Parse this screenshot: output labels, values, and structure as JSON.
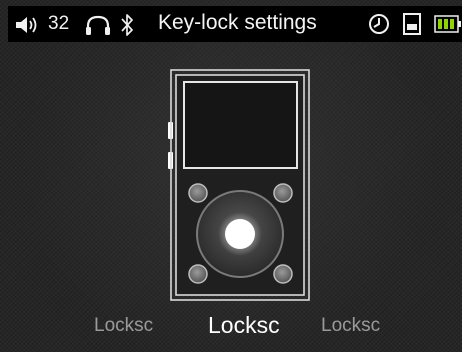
{
  "status_bar": {
    "volume_icon": "speaker-icon",
    "volume_level": "32",
    "headphone_icon": "headphone-icon",
    "bluetooth_icon": "bluetooth-icon",
    "title": "Key-lock settings",
    "clock_icon": "clock-icon",
    "sd_card_icon": "sd-card-icon",
    "battery_icon": "battery-icon",
    "battery_color": "#8fd400"
  },
  "lock_options": {
    "prev_label": "Locksc",
    "selected_label": "Locksc",
    "next_label": "Locksc"
  },
  "colors": {
    "background": "#262626",
    "status_bar": "#000000",
    "outline": "#d9d9d9"
  }
}
